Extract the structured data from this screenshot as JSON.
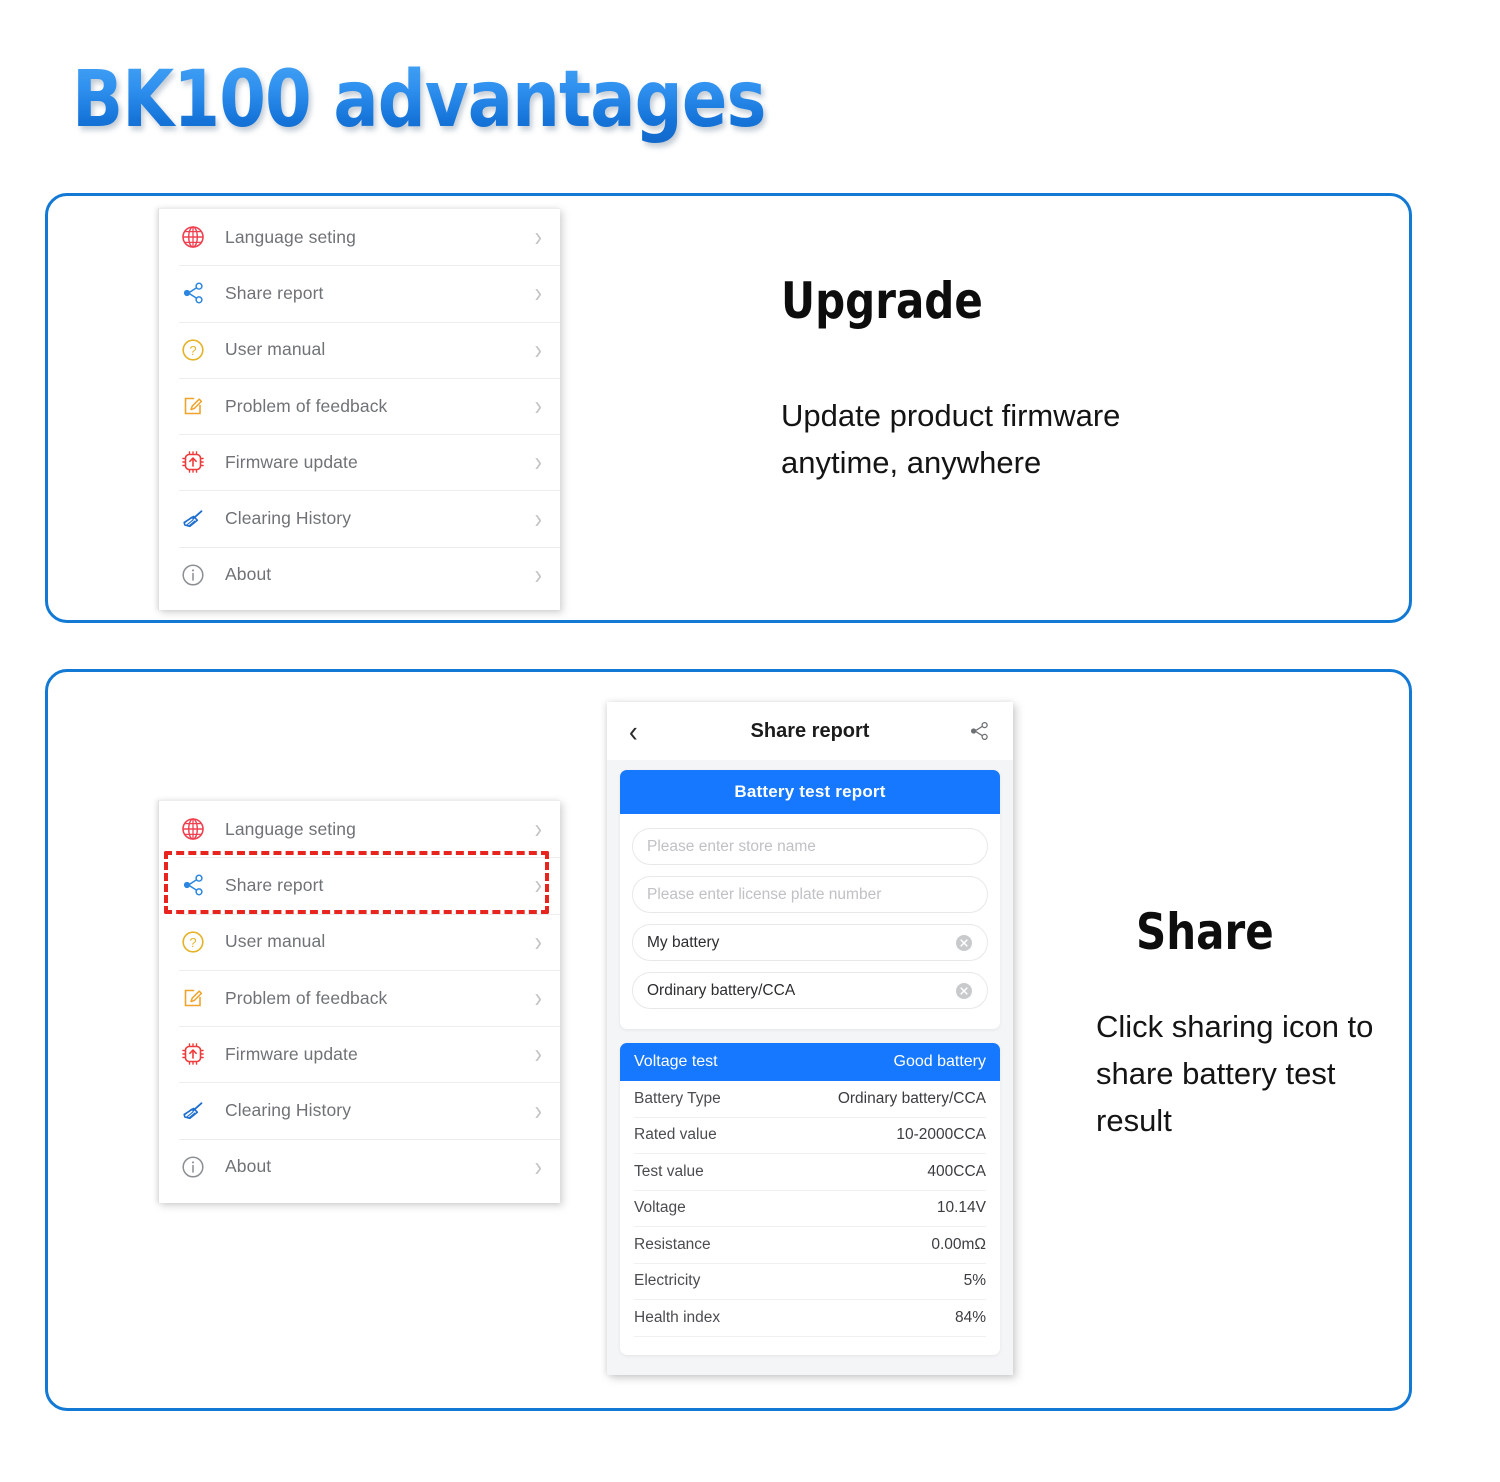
{
  "title": "BK100 advantages",
  "theme": {
    "panel_border": "#1279d4",
    "accent_blue": "#1677ff",
    "highlight_red": "#e8241f"
  },
  "settings_menu": {
    "items": [
      {
        "label": "Language seting",
        "icon": "globe-icon",
        "chevron": "›"
      },
      {
        "label": "Share report",
        "icon": "share-icon",
        "chevron": "›"
      },
      {
        "label": "User manual",
        "icon": "question-circle-icon",
        "chevron": "›"
      },
      {
        "label": "Problem of feedback",
        "icon": "edit-note-icon",
        "chevron": "›"
      },
      {
        "label": "Firmware update",
        "icon": "chip-upload-icon",
        "chevron": "›"
      },
      {
        "label": "Clearing History",
        "icon": "broom-icon",
        "chevron": "›"
      },
      {
        "label": "About",
        "icon": "info-circle-icon",
        "chevron": "›"
      }
    ]
  },
  "upgrade_section": {
    "heading": "Upgrade",
    "body": "Update product firmware anytime, anywhere"
  },
  "share_section": {
    "heading": "Share",
    "body": "Click sharing icon to share battery test result"
  },
  "phone": {
    "nav": {
      "back_icon": "‹",
      "title": "Share report",
      "share_icon": "share-icon"
    },
    "report": {
      "header": "Battery test report",
      "fields": [
        {
          "value": "",
          "placeholder": "Please enter store name",
          "clearable": false
        },
        {
          "value": "",
          "placeholder": "Please enter license plate number",
          "clearable": false
        },
        {
          "value": "My battery",
          "placeholder": "",
          "clearable": true
        },
        {
          "value": "Ordinary battery/CCA",
          "placeholder": "",
          "clearable": true
        }
      ]
    },
    "result": {
      "header_left": "Voltage test",
      "header_right": "Good battery",
      "rows": [
        {
          "label": "Battery Type",
          "value": "Ordinary battery/CCA"
        },
        {
          "label": "Rated value",
          "value": "10-2000CCA"
        },
        {
          "label": "Test value",
          "value": "400CCA"
        },
        {
          "label": "Voltage",
          "value": "10.14V"
        },
        {
          "label": "Resistance",
          "value": "0.00mΩ"
        },
        {
          "label": "Electricity",
          "value": "5%"
        },
        {
          "label": "Health index",
          "value": "84%"
        }
      ]
    }
  }
}
